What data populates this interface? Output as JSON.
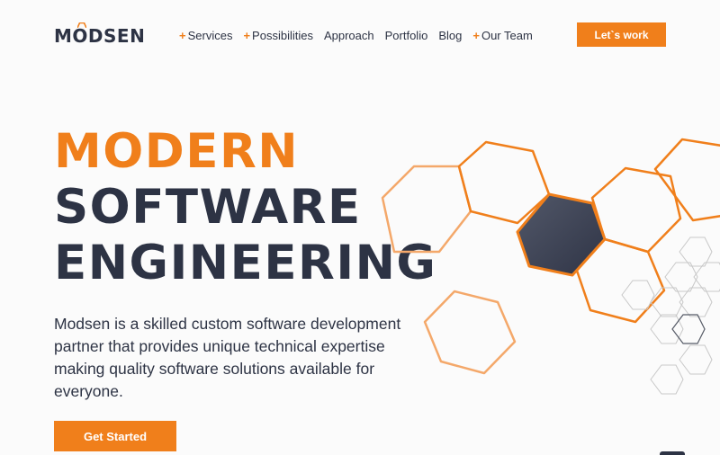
{
  "brand": {
    "name": "MODSEN",
    "accent": "#f07f1b",
    "dark": "#2d3344"
  },
  "nav": {
    "items": [
      {
        "label": "Services",
        "has_plus": true
      },
      {
        "label": "Possibilities",
        "has_plus": true
      },
      {
        "label": "Approach",
        "has_plus": false
      },
      {
        "label": "Portfolio",
        "has_plus": false
      },
      {
        "label": "Blog",
        "has_plus": false
      },
      {
        "label": "Our Team",
        "has_plus": true
      }
    ],
    "cta_label": "Let`s work"
  },
  "hero": {
    "headline": [
      "MODERN",
      "SOFTWARE",
      "ENGINEERING"
    ],
    "description": "Modsen is a skilled custom software development partner that provides unique technical expertise making quality software solutions available for everyone.",
    "cta_label": "Get Started"
  }
}
